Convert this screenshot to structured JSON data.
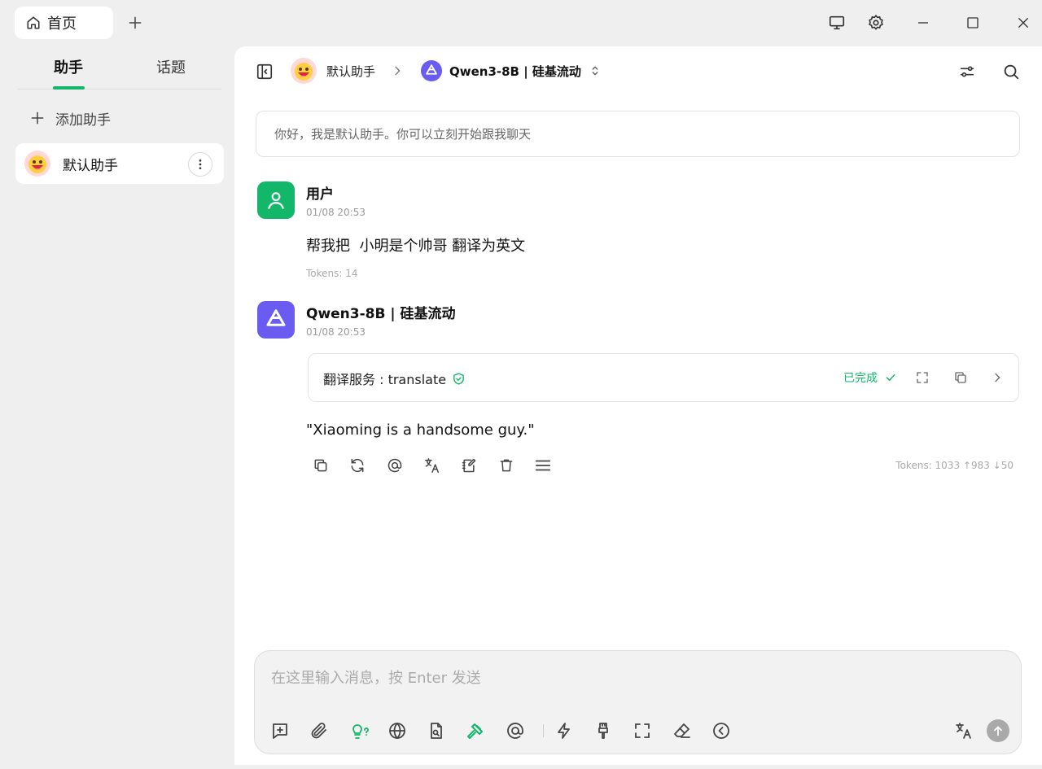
{
  "titlebar": {
    "home_tab_label": "首页"
  },
  "sidebar": {
    "tabs": [
      {
        "label": "助手",
        "active": true
      },
      {
        "label": "话题",
        "active": false
      }
    ],
    "add_label": "添加助手",
    "assistants": [
      {
        "name": "默认助手"
      }
    ]
  },
  "header": {
    "assistant_name": "默认助手",
    "model_name": "Qwen3-8B | 硅基流动"
  },
  "welcome_text": "你好，我是默认助手。你可以立刻开始跟我聊天",
  "messages": {
    "user": {
      "name": "用户",
      "time": "01/08 20:53",
      "content": "帮我把  小明是个帅哥 翻译为英文",
      "tokens": "Tokens: 14"
    },
    "assistant": {
      "name": "Qwen3-8B | 硅基流动",
      "time": "01/08 20:53",
      "tool_call": {
        "name": "翻译服务 : translate",
        "status": "已完成"
      },
      "content": "\"Xiaoming is a handsome guy.\"",
      "tokens": "Tokens: 1033 ↑983 ↓50"
    }
  },
  "input": {
    "placeholder": "在这里输入消息，按 Enter 发送",
    "value": ""
  },
  "colors": {
    "accent": "#12b76a",
    "model_purple": "#6a5cf0",
    "main_bg": "#ffffff",
    "app_bg": "#efefef"
  }
}
